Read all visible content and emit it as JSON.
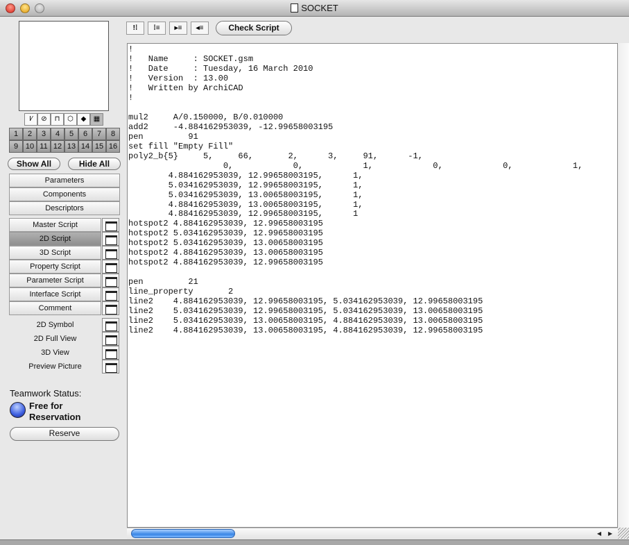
{
  "window": {
    "title": "SOCKET"
  },
  "toolbar": {
    "check_script": "Check Script",
    "icons": [
      "insert-comment-icon",
      "list-icon",
      "indent-icon",
      "outdent-icon"
    ]
  },
  "sidebar": {
    "view_icons": [
      "2d-line-icon",
      "section-icon",
      "floorplan-icon",
      "wireframe-3d-icon",
      "solid-3d-icon",
      "preview-film-icon"
    ],
    "numbers": [
      "1",
      "2",
      "3",
      "4",
      "5",
      "6",
      "7",
      "8",
      "9",
      "10",
      "11",
      "12",
      "13",
      "14",
      "15",
      "16"
    ],
    "show_all": "Show All",
    "hide_all": "Hide All",
    "sections": [
      "Parameters",
      "Components",
      "Descriptors"
    ],
    "scripts": [
      "Master Script",
      "2D Script",
      "3D Script",
      "Property Script",
      "Parameter Script",
      "Interface Script",
      "Comment"
    ],
    "selected_script": "2D Script",
    "views": [
      "2D Symbol",
      "2D Full View",
      "3D View",
      "Preview Picture"
    ],
    "teamwork_label": "Teamwork Status:",
    "teamwork_status": "Free for Reservation",
    "reserve": "Reserve"
  },
  "editor": {
    "lines": [
      "!",
      "!   Name     : SOCKET.gsm",
      "!   Date     : Tuesday, 16 March 2010",
      "!   Version  : 13.00",
      "!   Written by ArchiCAD",
      "!",
      "",
      "mul2     A/0.150000, B/0.010000",
      "add2     -4.884162953039, -12.99658003195",
      "pen         91",
      "set fill \"Empty Fill\"",
      "poly2_b{5}     5,     66,       2,      3,     91,      -1,",
      "                   0,            0,            1,            0,            0,            1,",
      "        4.884162953039, 12.99658003195,      1,",
      "        5.034162953039, 12.99658003195,      1,",
      "        5.034162953039, 13.00658003195,      1,",
      "        4.884162953039, 13.00658003195,      1,",
      "        4.884162953039, 12.99658003195,      1",
      "hotspot2 4.884162953039, 12.99658003195",
      "hotspot2 5.034162953039, 12.99658003195",
      "hotspot2 5.034162953039, 13.00658003195",
      "hotspot2 4.884162953039, 13.00658003195",
      "hotspot2 4.884162953039, 12.99658003195",
      "",
      "pen         21",
      "line_property       2",
      "line2    4.884162953039, 12.99658003195, 5.034162953039, 12.99658003195",
      "line2    5.034162953039, 12.99658003195, 5.034162953039, 13.00658003195",
      "line2    5.034162953039, 13.00658003195, 4.884162953039, 13.00658003195",
      "line2    4.884162953039, 13.00658003195, 4.884162953039, 12.99658003195"
    ]
  }
}
